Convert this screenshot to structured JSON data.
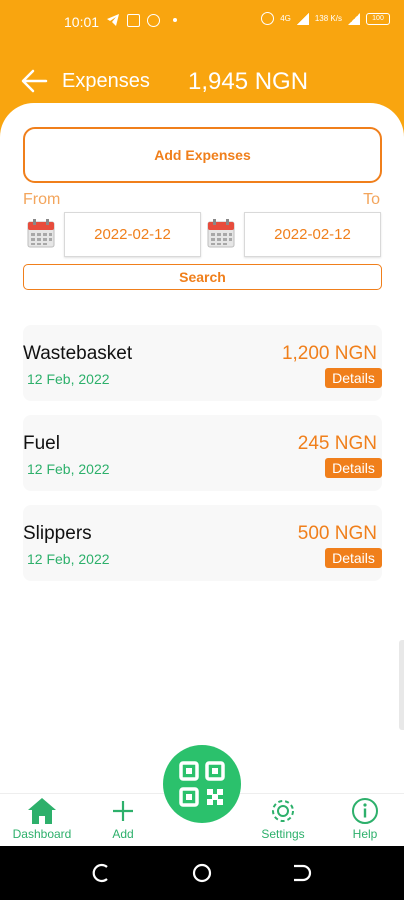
{
  "status_bar": {
    "time": "10:01",
    "battery": "100",
    "net_top": "4G",
    "net_speed": "138 K/s"
  },
  "header": {
    "title": "Expenses",
    "total": "1,945 NGN"
  },
  "actions": {
    "add_label": "Add Expenses",
    "search_label": "Search"
  },
  "filter": {
    "from_label": "From",
    "to_label": "To",
    "from_value": "2022-02-12",
    "to_value": "2022-02-12"
  },
  "expenses": [
    {
      "name": "Wastebasket",
      "date": "12 Feb, 2022",
      "amount": "1,200 NGN",
      "details_label": "Details"
    },
    {
      "name": "Fuel",
      "date": "12 Feb, 2022",
      "amount": "245 NGN",
      "details_label": "Details"
    },
    {
      "name": "Slippers",
      "date": "12 Feb, 2022",
      "amount": "500 NGN",
      "details_label": "Details"
    }
  ],
  "nav": {
    "dashboard": "Dashboard",
    "add": "Add",
    "settings": "Settings",
    "help": "Help"
  },
  "icons": {
    "back": "arrow-left-icon",
    "calendar": "calendar-icon",
    "qr": "qr-code-icon",
    "dashboard": "home-icon",
    "add": "plus-icon",
    "settings": "gear-icon",
    "help": "info-icon"
  },
  "colors": {
    "header_bg": "#f9a50f",
    "accent": "#f07f1b",
    "green": "#2db06b",
    "fab": "#2bc16c"
  }
}
